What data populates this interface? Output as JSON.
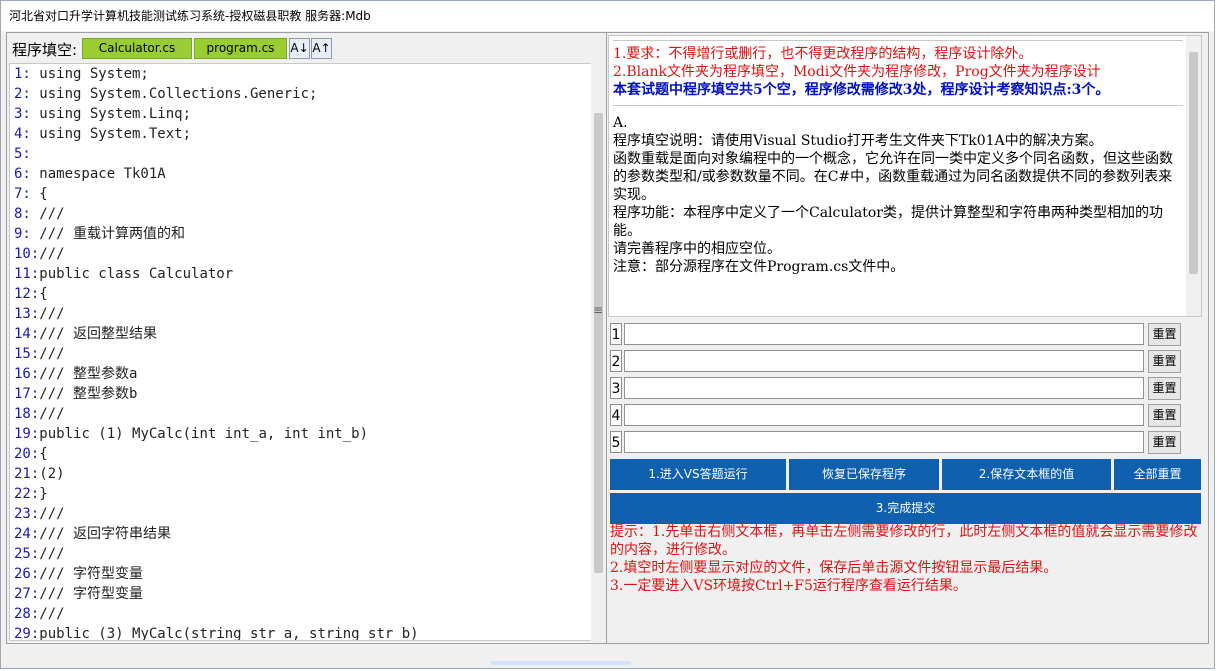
{
  "window": {
    "title": "河北省对口升学计算机技能测试练习系统-授权磁县职教  服务器:Mdb"
  },
  "toolbar": {
    "label": "程序填空:",
    "tabs": [
      "Calculator.cs",
      "program.cs"
    ],
    "sort_asc": "A↓",
    "sort_desc": "A↑"
  },
  "code": {
    "lines": [
      {
        "n": "1:",
        "t": " using System;"
      },
      {
        "n": "2:",
        "t": " using System.Collections.Generic;"
      },
      {
        "n": "3:",
        "t": " using System.Linq;"
      },
      {
        "n": "4:",
        "t": " using System.Text;"
      },
      {
        "n": "5:",
        "t": ""
      },
      {
        "n": "6:",
        "t": " namespace Tk01A"
      },
      {
        "n": "7:",
        "t": " {"
      },
      {
        "n": "8:",
        "t": " ///"
      },
      {
        "n": "9:",
        "t": " /// 重载计算两值的和"
      },
      {
        "n": "10:",
        "t": "///"
      },
      {
        "n": "11:",
        "t": "public class Calculator"
      },
      {
        "n": "12:",
        "t": "{"
      },
      {
        "n": "13:",
        "t": "///"
      },
      {
        "n": "14:",
        "t": "/// 返回整型结果"
      },
      {
        "n": "15:",
        "t": "///"
      },
      {
        "n": "16:",
        "t": "/// 整型参数a"
      },
      {
        "n": "17:",
        "t": "/// 整型参数b"
      },
      {
        "n": "18:",
        "t": "///"
      },
      {
        "n": "19:",
        "t": "public (1) MyCalc(int int_a, int int_b)"
      },
      {
        "n": "20:",
        "t": "{"
      },
      {
        "n": "21:",
        "t": "(2)"
      },
      {
        "n": "22:",
        "t": "}"
      },
      {
        "n": "23:",
        "t": "///"
      },
      {
        "n": "24:",
        "t": "/// 返回字符串结果"
      },
      {
        "n": "25:",
        "t": "///"
      },
      {
        "n": "26:",
        "t": "/// 字符型变量"
      },
      {
        "n": "27:",
        "t": "/// 字符型变量"
      },
      {
        "n": "28:",
        "t": "///"
      },
      {
        "n": "29:",
        "t": "public (3) MyCalc(string str_a, string str_b)"
      }
    ]
  },
  "info": {
    "req1": "1.要求：不得增行或删行，也不得更改程序的结构，程序设计除外。",
    "req2": "2.Blank文件夹为程序填空，Modi文件夹为程序修改，Prog文件夹为程序设计",
    "summary": "本套试题中程序填空共5个空，程序修改需修改3处，程序设计考察知识点:3个。",
    "section": "A.",
    "p1": "程序填空说明：请使用Visual Studio打开考生文件夹下Tk01A中的解决方案。",
    "p2": "函数重载是面向对象编程中的一个概念，它允许在同一类中定义多个同名函数，但这些函数的参数类型和/或参数数量不同。在C#中，函数重载通过为同名函数提供不同的参数列表来实现。",
    "p3": "程序功能：本程序中定义了一个Calculator类，提供计算整型和字符串两种类型相加的功能。",
    "p4": "请完善程序中的相应空位。",
    "p5": "注意：部分源程序在文件Program.cs文件中。"
  },
  "blanks": {
    "numbers": [
      "1",
      "2",
      "3",
      "4",
      "5"
    ],
    "values": [
      "",
      "",
      "",
      "",
      ""
    ],
    "reset_label": "重置"
  },
  "actions": {
    "enter_vs": "1.进入VS答题运行",
    "restore": "恢复已保存程序",
    "save": "2.保存文本框的值",
    "reset_all": "全部重置",
    "submit": "3.完成提交"
  },
  "hints": {
    "h1": "提示：1.先单击右侧文本框，再单击左侧需要修改的行，此时左侧文本框的值就会显示需要修改的内容，进行修改。",
    "h2": "2.填空时左侧要显示对应的文件，保存后单击源文件按钮显示最后结果。",
    "h3": "3.一定要进入VS环境按Ctrl+F5运行程序查看运行结果。"
  }
}
